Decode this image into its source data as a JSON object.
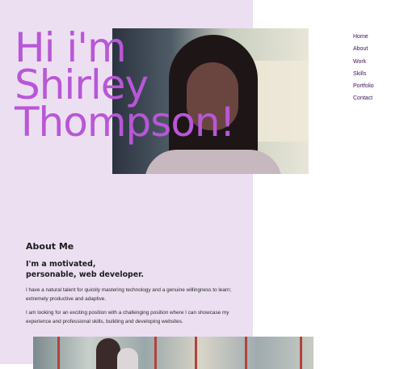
{
  "hero": {
    "line1": "Hi i'm",
    "line2": "Shirley",
    "line3": "Thompson!"
  },
  "nav": {
    "items": [
      {
        "label": "Home"
      },
      {
        "label": "About"
      },
      {
        "label": "Work"
      },
      {
        "label": "Skills"
      },
      {
        "label": "Portfolio"
      },
      {
        "label": "Contact"
      }
    ]
  },
  "about": {
    "heading": "About Me",
    "subheading": "I'm a motivated, personable, web developer.",
    "paragraph1": "I have a natural talent for quickly mastering technology and a genuine willingness to learn; extremely productive and adaptive.",
    "paragraph2": "I am looking for an exciting position with a challenging position where I can showcase my experience and professional skills, building and developing websites."
  },
  "colors": {
    "accent": "#b857d7",
    "panel": "#ecdff1",
    "nav_text": "#3d1159"
  }
}
